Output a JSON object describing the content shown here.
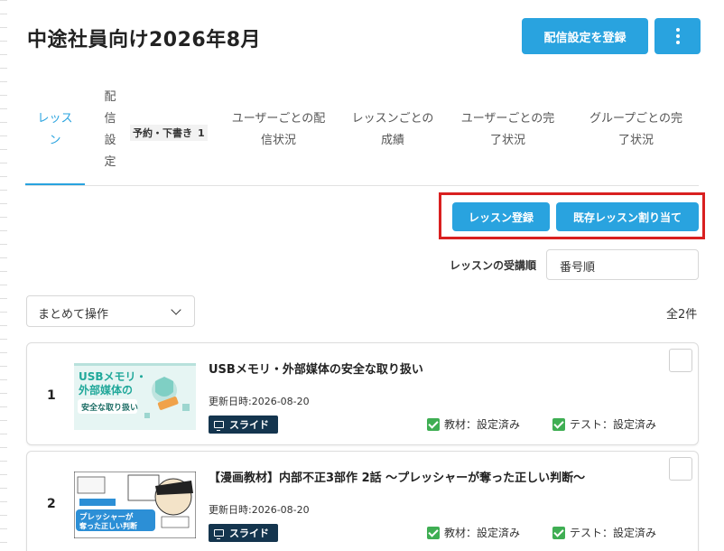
{
  "page": {
    "title": "中途社員向け2026年8月"
  },
  "header": {
    "register_delivery_label": "配信設定を登録"
  },
  "tabs": [
    {
      "label": "レッス\nン"
    },
    {
      "label": "配\n信\n設\n定"
    },
    {
      "label": "ユーザーごとの配\n信状況"
    },
    {
      "label": "レッスンごとの\n成績"
    },
    {
      "label": "ユーザーごとの完\n了状況"
    },
    {
      "label": "グループごとの完\n了状況"
    }
  ],
  "tab_badge": {
    "label": "予約・下書き",
    "count": "1"
  },
  "actions": {
    "lesson_register_label": "レッスン登録",
    "assign_existing_label": "既存レッスン割り当て"
  },
  "order": {
    "label": "レッスンの受講順",
    "value": "番号順"
  },
  "bulk": {
    "label": "まとめて操作"
  },
  "total": {
    "label": "全2件"
  },
  "lessons": [
    {
      "number": "1",
      "title": "USBメモリ・外部媒体の安全な取り扱い",
      "updated": "更新日時:2026-08-20",
      "type": "スライド",
      "material_status": "教材：設定済み",
      "test_status": "テスト：設定済み",
      "thumb": {
        "line1": "USBメモリ・",
        "line2": "外部媒体の",
        "line3": "安全な取り扱い"
      }
    },
    {
      "number": "2",
      "title": "【漫画教材】内部不正3部作 2話 〜プレッシャーが奪った正しい判断〜",
      "updated": "更新日時:2026-08-20",
      "type": "スライド",
      "material_status": "教材：設定済み",
      "test_status": "テスト：設定済み",
      "thumb": {
        "line1": "プレッシャーが",
        "line2": "奪った正しい判断"
      }
    }
  ]
}
